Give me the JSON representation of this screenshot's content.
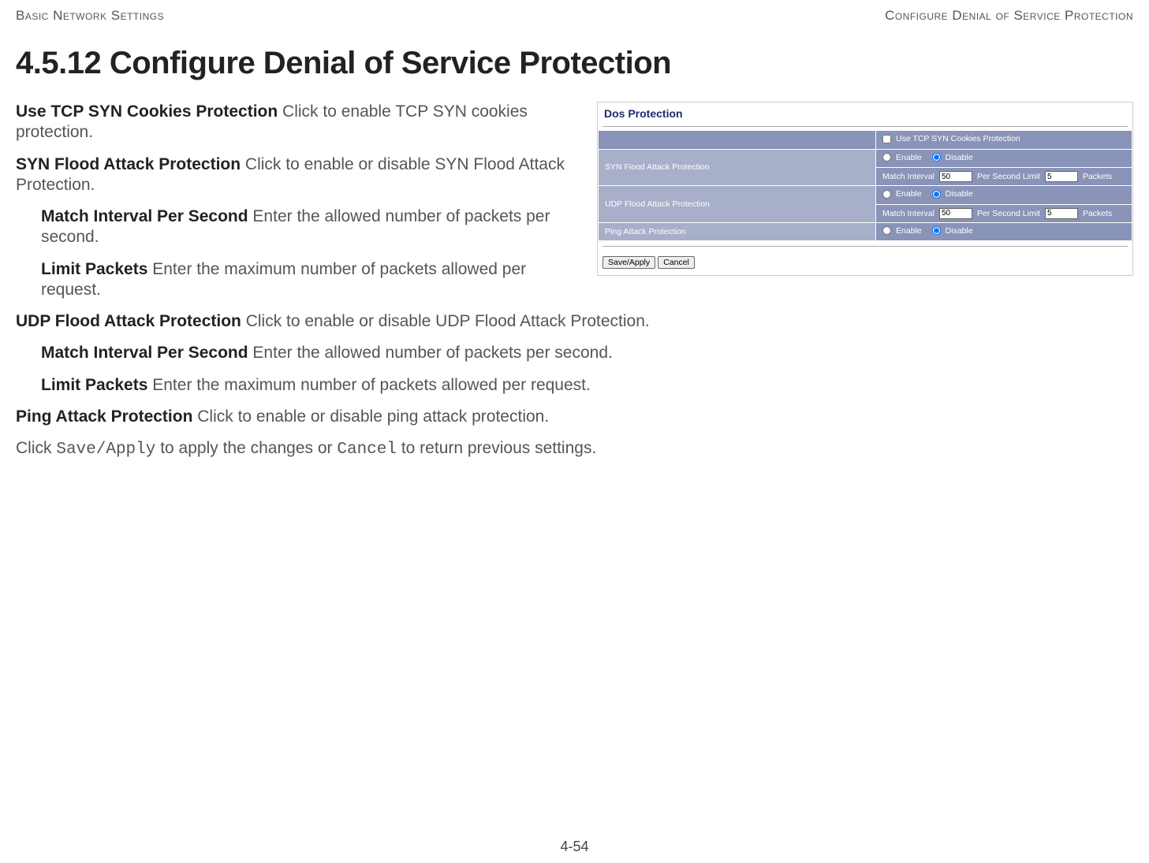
{
  "header": {
    "left": "Basic Network Settings",
    "right": "Configure Denial of Service Protection"
  },
  "title": "4.5.12 Configure Denial of Service Protection",
  "body": {
    "p1_term": "Use TCP SYN Cookies Protection",
    "p1_text": "  Click to enable TCP SYN cookies protection.",
    "p2_term": "SYN Flood Attack Protection",
    "p2_text": "  Click to enable or disable SYN Flood Attack Protection.",
    "p2a_term": "Match Interval Per Second",
    "p2a_text": "   Enter the allowed number of packets per second.",
    "p2b_term": "Limit Packets",
    "p2b_text": "  Enter the maximum number of packets allowed per request.",
    "p3_term": "UDP Flood Attack Protection",
    "p3_text": "  Click to enable or disable UDP Flood Attack Protection.",
    "p3a_term": "Match Interval Per Second",
    "p3a_text": "   Enter the allowed number of packets per second.",
    "p3b_term": "Limit Packets",
    "p3b_text": "  Enter the maximum number of packets allowed per request.",
    "p4_term": "Ping Attack Protection",
    "p4_text": "  Click to enable or disable ping attack protection.",
    "p5_pre": "Click ",
    "p5_code1": "Save/Apply",
    "p5_mid": " to apply the changes or ",
    "p5_code2": "Cancel",
    "p5_post": " to return previous settings."
  },
  "panel": {
    "title": "Dos Protection",
    "rows": {
      "tcp_cookies": "Use TCP SYN Cookies Protection",
      "syn_label": "SYN Flood Attack Protection",
      "udp_label": "UDP Flood Attack Protection",
      "ping_label": "Ping Attack Protection",
      "enable": "Enable",
      "disable": "Disable",
      "match_interval": "Match Interval",
      "per_second_limit": "Per Second  Limit",
      "packets": "Packets",
      "syn_interval_val": "50",
      "syn_limit_val": "5",
      "udp_interval_val": "50",
      "udp_limit_val": "5"
    },
    "buttons": {
      "save": "Save/Apply",
      "cancel": "Cancel"
    }
  },
  "footer": "4-54"
}
